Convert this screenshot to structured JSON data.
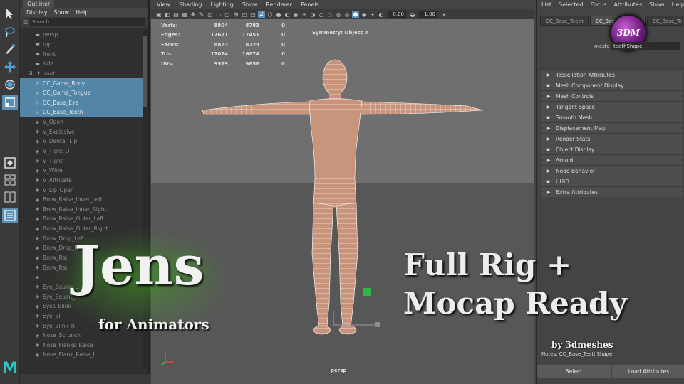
{
  "toolbox": {
    "tools": [
      "select-tool",
      "lasso-tool",
      "paint-select-tool",
      "move-tool",
      "rotate-tool",
      "scale-tool"
    ],
    "app_logo": "M"
  },
  "outliner": {
    "tab": "Outliner",
    "menu": [
      "Display",
      "Show",
      "Help"
    ],
    "search_placeholder": "Search...",
    "items": [
      {
        "label": "persp",
        "icon": "camera",
        "selected": false
      },
      {
        "label": "top",
        "icon": "camera",
        "selected": false
      },
      {
        "label": "front",
        "icon": "camera",
        "selected": false
      },
      {
        "label": "side",
        "icon": "camera",
        "selected": false
      },
      {
        "label": "root",
        "icon": "joint",
        "selected": false
      },
      {
        "label": "CC_Game_Body",
        "icon": "mesh",
        "selected": true
      },
      {
        "label": "CC_Game_Tongue",
        "icon": "mesh",
        "selected": true
      },
      {
        "label": "CC_Base_Eye",
        "icon": "mesh",
        "selected": true
      },
      {
        "label": "CC_Base_Teeth",
        "icon": "mesh",
        "selected": true
      },
      {
        "label": "V_Open",
        "icon": "mesh",
        "selected": false
      },
      {
        "label": "V_Explosive",
        "icon": "mesh",
        "selected": false
      },
      {
        "label": "V_Dental_Lip",
        "icon": "mesh",
        "selected": false
      },
      {
        "label": "V_Tight_O",
        "icon": "mesh",
        "selected": false
      },
      {
        "label": "V_Tight",
        "icon": "mesh",
        "selected": false
      },
      {
        "label": "V_Wide",
        "icon": "mesh",
        "selected": false
      },
      {
        "label": "V_Affricate",
        "icon": "mesh",
        "selected": false
      },
      {
        "label": "V_Lip_Open",
        "icon": "mesh",
        "selected": false
      },
      {
        "label": "Brow_Raise_Inner_Left",
        "icon": "mesh",
        "selected": false
      },
      {
        "label": "Brow_Raise_Inner_Right",
        "icon": "mesh",
        "selected": false
      },
      {
        "label": "Brow_Raise_Outer_Left",
        "icon": "mesh",
        "selected": false
      },
      {
        "label": "Brow_Raise_Outer_Right",
        "icon": "mesh",
        "selected": false
      },
      {
        "label": "Brow_Drop_Left",
        "icon": "mesh",
        "selected": false
      },
      {
        "label": "Brow_Drop_Right",
        "icon": "mesh",
        "selected": false
      },
      {
        "label": "Brow_Rai",
        "icon": "mesh",
        "selected": false
      },
      {
        "label": "Brow_Rai",
        "icon": "mesh",
        "selected": false
      },
      {
        "label": "",
        "icon": "mesh",
        "selected": false
      },
      {
        "label": "Eye_Squint_L",
        "icon": "mesh",
        "selected": false
      },
      {
        "label": "Eye_Squint_R",
        "icon": "mesh",
        "selected": false
      },
      {
        "label": "Eyes_Blink",
        "icon": "mesh",
        "selected": false
      },
      {
        "label": "Eye_Bl",
        "icon": "mesh",
        "selected": false
      },
      {
        "label": "Eye_Blink_R",
        "icon": "mesh",
        "selected": false
      },
      {
        "label": "Nose_Scrunch",
        "icon": "mesh",
        "selected": false
      },
      {
        "label": "Nose_Flanks_Raise",
        "icon": "mesh",
        "selected": false
      },
      {
        "label": "Nose_Flank_Raise_L",
        "icon": "mesh",
        "selected": false
      }
    ]
  },
  "viewport": {
    "menu": [
      "View",
      "Shading",
      "Lighting",
      "Show",
      "Renderer",
      "Panels"
    ],
    "exposure": "0.00",
    "gamma": "1.00",
    "hud": {
      "rows": [
        {
          "label": "Verts:",
          "a": "8904",
          "b": "8783",
          "c": "0"
        },
        {
          "label": "Edges:",
          "a": "17671",
          "b": "17451",
          "c": "0"
        },
        {
          "label": "Faces:",
          "a": "8823",
          "b": "8723",
          "c": "0"
        },
        {
          "label": "Tris:",
          "a": "17074",
          "b": "16874",
          "c": "0"
        },
        {
          "label": "UVs:",
          "a": "9979",
          "b": "9858",
          "c": "0"
        }
      ],
      "symmetry": "Symmetry: Object X"
    },
    "camera": "persp",
    "colors": {
      "background": "#6f6f6f",
      "ground": "#575757",
      "mesh": "#d6a48a",
      "wire": "#ffffff"
    }
  },
  "attribute_editor": {
    "menu": [
      "List",
      "Selected",
      "Focus",
      "Attributes",
      "Show",
      "Help"
    ],
    "tabs": [
      "CC_Base_Teeth",
      "CC_Base_",
      "CC_Base_Te"
    ],
    "mesh_label": "mesh:",
    "mesh_value": "teethShape",
    "sections": [
      "Tessellation Attributes",
      "Mesh Component Display",
      "Mesh Controls",
      "Tangent Space",
      "Smooth Mesh",
      "Displacement Map",
      "Render Stats",
      "Object Display",
      "Arnold",
      "Node Behavior",
      "UUID",
      "Extra Attributes"
    ],
    "notes": "Notes:  CC_Base_TeethShape",
    "buttons": [
      "Select",
      "Load Attributes"
    ],
    "logo": "3DM"
  },
  "promo": {
    "title": "Jens",
    "subtitle": "for Animators",
    "right_line1": "Full Rig +",
    "right_line2": "Mocap Ready",
    "by": "by 3dmeshes"
  }
}
